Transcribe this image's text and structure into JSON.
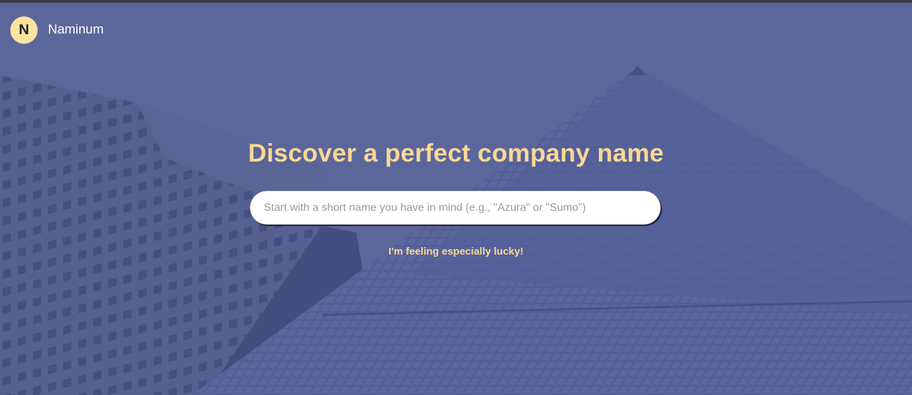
{
  "brand": {
    "logo_letter": "N",
    "name": "Naminum"
  },
  "hero": {
    "title": "Discover a perfect company name"
  },
  "search": {
    "value": "",
    "placeholder": "Start with a short name you have in mind (e.g., \"Azura\" or \"Sumo\")"
  },
  "lucky": {
    "label": "I'm feeling especially lucky!"
  },
  "colors": {
    "accent": "#fbd893",
    "logo_bg": "#fde3a0",
    "overlay": "#4f5a8a"
  },
  "icons": {
    "background": "skyscraper-photo"
  }
}
